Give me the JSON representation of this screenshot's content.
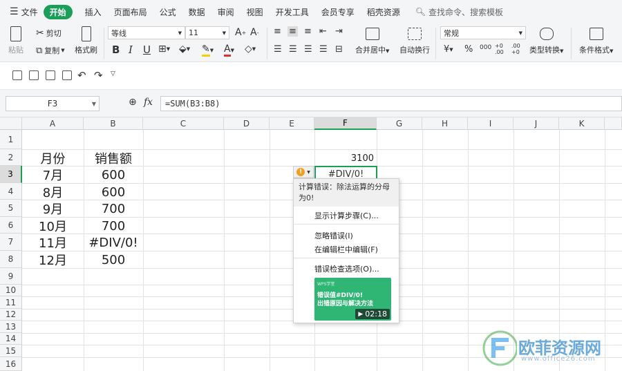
{
  "menu": {
    "file": "文件",
    "tabs": [
      "开始",
      "插入",
      "页面布局",
      "公式",
      "数据",
      "审阅",
      "视图",
      "开发工具",
      "会员专享",
      "稻壳资源"
    ],
    "search_placeholder": "查找命令、搜索模板"
  },
  "ribbon": {
    "paste": "粘贴",
    "cut": "剪切",
    "copy": "复制",
    "format_painter": "格式刷",
    "font_name": "等线",
    "font_size": "11",
    "bold": "B",
    "italic": "I",
    "underline": "U",
    "merge_center": "合并居中",
    "wrap_text": "自动换行",
    "number_format": "常规",
    "currency": "¥",
    "percent": "%",
    "thousands": "000",
    "inc_decimal": "+0 .00",
    "dec_decimal": ".00 +0",
    "type_convert": "类型转换",
    "cond_format": "条件格式"
  },
  "formula_bar": {
    "name_box": "F3",
    "fx": "fx",
    "formula": "=SUM(B3:B8)"
  },
  "sheet": {
    "columns": [
      "A",
      "B",
      "C",
      "D",
      "E",
      "F",
      "G",
      "H",
      "I",
      "J",
      "K"
    ],
    "rows": [
      "1",
      "2",
      "3",
      "4",
      "5",
      "6",
      "7",
      "8",
      "9",
      "10",
      "11",
      "12",
      "13",
      "14",
      "15",
      "16"
    ],
    "header_month": "月份",
    "header_sales": "销售额",
    "months": [
      "7月",
      "8月",
      "9月",
      "10月",
      "11月",
      "12月"
    ],
    "sales": [
      "600",
      "600",
      "700",
      "700",
      "#DIV/0!",
      "500"
    ],
    "f2_value": "3100",
    "f3_value": "#DIV/0!"
  },
  "error_popup": {
    "message": "计算错误：除法运算的分母为0!",
    "items": [
      "显示计算步骤(C)...",
      "忽略错误(I)",
      "在编辑栏中编辑(F)",
      "错误检查选项(O)..."
    ],
    "video_tag": "WPS学堂",
    "video_title_1": "错误值#DIV/0!",
    "video_title_2": "出错原因与解决方法",
    "video_time": "02:18"
  },
  "watermark": {
    "name": "欧菲资源网",
    "url": "www.office26.com"
  },
  "colors": {
    "accent": "#18a058",
    "warning": "#f0a020"
  }
}
